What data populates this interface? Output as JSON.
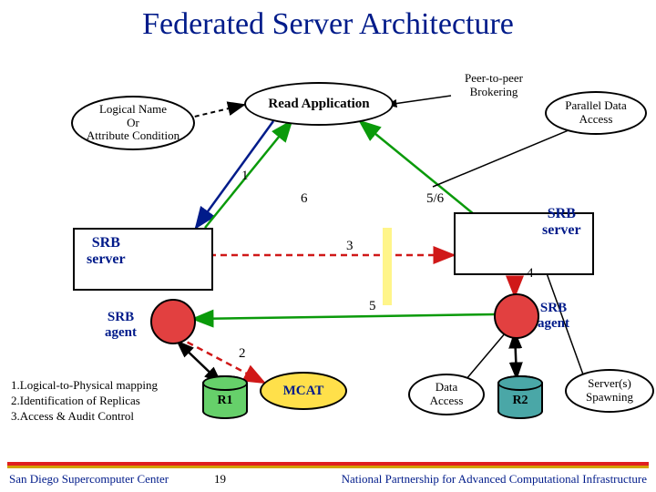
{
  "title": "Federated Server Architecture",
  "nodes": {
    "logical_name": "Logical Name\nOr\nAttribute Condition",
    "read_app": "Read Application",
    "p2p": "Peer-to-peer\nBrokering",
    "parallel": "Parallel Data\nAccess",
    "srb_server_left": "SRB\nserver",
    "srb_server_right": "SRB\nserver",
    "srb_agent_left": "SRB\nagent",
    "srb_agent_right": "SRB\nagent",
    "mcat": "MCAT",
    "data_access": "Data\nAccess",
    "r1": "R1",
    "r2": "R2",
    "servers_spawn": "Server(s)\nSpawning"
  },
  "steps": {
    "s1": "1",
    "s2": "2",
    "s3": "3",
    "s4": "4",
    "s5": "5",
    "s6": "6",
    "s56": "5/6"
  },
  "annotations": {
    "list": "1.Logical-to-Physical mapping\n2.Identification of Replicas\n3.Access & Audit Control"
  },
  "footer": {
    "left": "San Diego Supercomputer Center",
    "right": "National Partnership for Advanced Computational Infrastructure",
    "page": "19"
  },
  "chart_data": {
    "type": "table",
    "title": "Federated Server Architecture",
    "nodes": [
      {
        "id": "logical_name",
        "label": "Logical Name Or Attribute Condition",
        "kind": "ellipse"
      },
      {
        "id": "read_app",
        "label": "Read Application",
        "kind": "ellipse"
      },
      {
        "id": "p2p",
        "label": "Peer-to-peer Brokering",
        "kind": "annotation-ellipse"
      },
      {
        "id": "parallel",
        "label": "Parallel Data Access",
        "kind": "annotation-ellipse"
      },
      {
        "id": "srb_server_left",
        "label": "SRB server",
        "kind": "server-box"
      },
      {
        "id": "srb_server_right",
        "label": "SRB server",
        "kind": "server-box"
      },
      {
        "id": "srb_agent_left",
        "label": "SRB agent",
        "kind": "circle"
      },
      {
        "id": "srb_agent_right",
        "label": "SRB agent",
        "kind": "circle"
      },
      {
        "id": "mcat",
        "label": "MCAT",
        "kind": "ellipse"
      },
      {
        "id": "data_access",
        "label": "Data Access",
        "kind": "annotation-ellipse"
      },
      {
        "id": "r1",
        "label": "R1",
        "kind": "cylinder"
      },
      {
        "id": "r2",
        "label": "R2",
        "kind": "cylinder"
      },
      {
        "id": "servers_spawn",
        "label": "Server(s) Spawning",
        "kind": "annotation-ellipse"
      }
    ],
    "edges": [
      {
        "from": "logical_name",
        "to": "read_app",
        "style": "dashed-black"
      },
      {
        "from": "read_app",
        "to": "srb_server_left",
        "label": "1",
        "style": "blue"
      },
      {
        "from": "srb_agent_left",
        "to": "mcat",
        "label": "2",
        "style": "dashed-red"
      },
      {
        "from": "srb_server_left",
        "to": "srb_server_right",
        "label": "3",
        "style": "dashed-red"
      },
      {
        "from": "srb_server_right",
        "to": "srb_agent_right",
        "label": "4",
        "style": "dashed-red"
      },
      {
        "from": "srb_agent_right",
        "to": "srb_agent_left",
        "label": "5",
        "style": "green"
      },
      {
        "from": "srb_server_left",
        "to": "read_app",
        "label": "6",
        "style": "green"
      },
      {
        "from": "srb_server_right",
        "to": "read_app",
        "label": "5/6",
        "style": "green"
      },
      {
        "from": "srb_agent_left",
        "to": "r1",
        "style": "double-black"
      },
      {
        "from": "srb_agent_right",
        "to": "r2",
        "style": "double-black"
      },
      {
        "from": "p2p",
        "to": "read_app",
        "style": "pointer"
      },
      {
        "from": "parallel",
        "to": "read_app",
        "style": "pointer"
      },
      {
        "from": "data_access",
        "to": "srb_agent_right",
        "style": "pointer"
      },
      {
        "from": "servers_spawn",
        "to": "srb_server_right",
        "style": "pointer"
      }
    ],
    "annotations": [
      "1.Logical-to-Physical mapping",
      "2.Identification of Replicas",
      "3.Access & Audit Control"
    ]
  }
}
